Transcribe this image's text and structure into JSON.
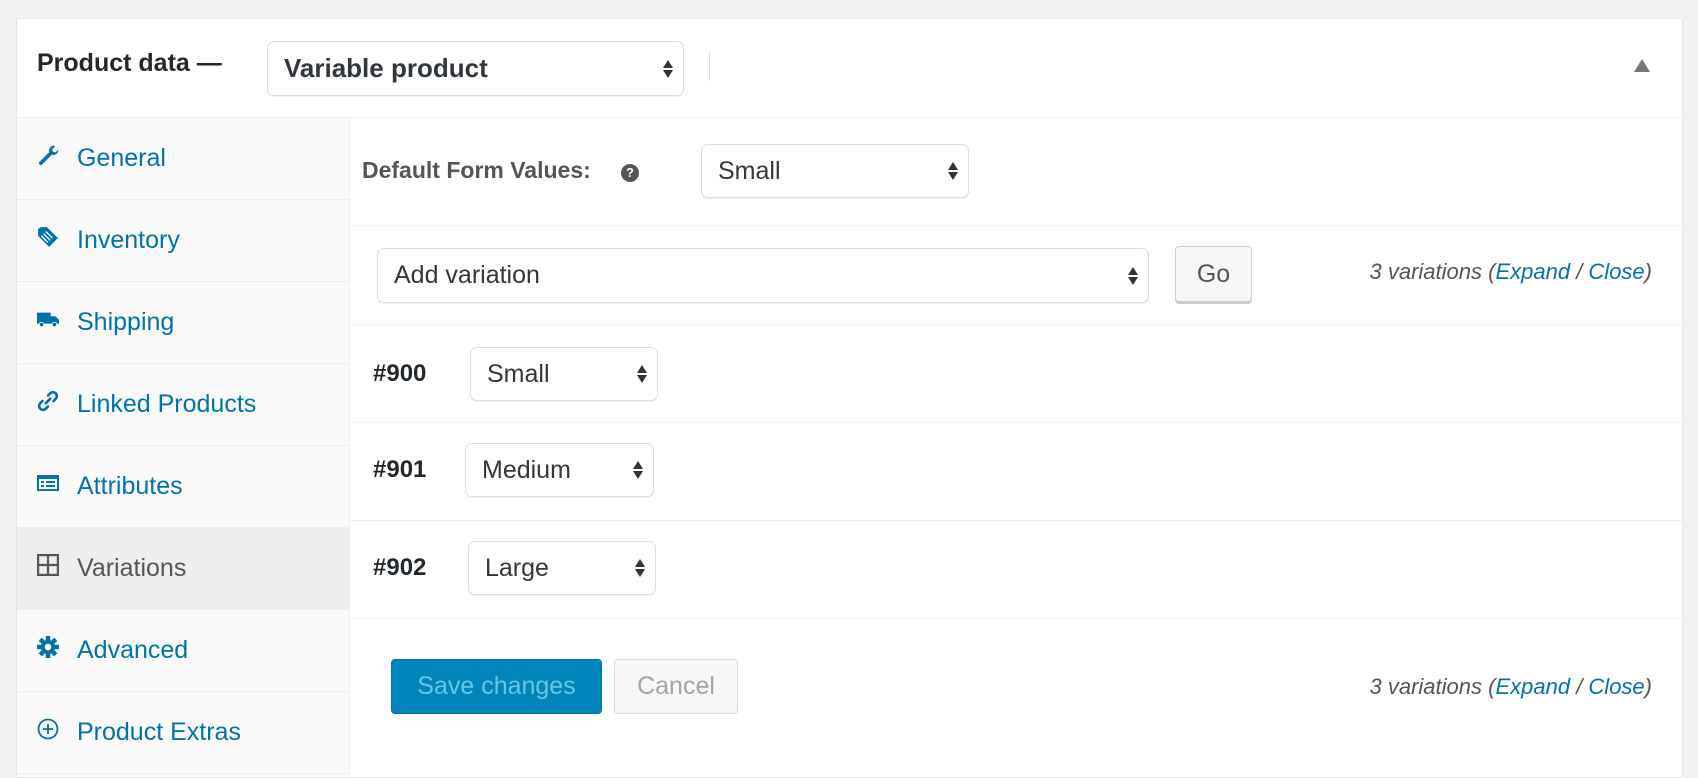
{
  "header": {
    "title": "Product data —",
    "product_type": "Variable product",
    "collapse_icon": "triangle-up-icon"
  },
  "sidebar": {
    "items": [
      {
        "label": "General",
        "icon": "wrench-icon",
        "active": false
      },
      {
        "label": "Inventory",
        "icon": "tag-icon",
        "active": false
      },
      {
        "label": "Shipping",
        "icon": "truck-icon",
        "active": false
      },
      {
        "label": "Linked Products",
        "icon": "link-icon",
        "active": false
      },
      {
        "label": "Attributes",
        "icon": "list-card-icon",
        "active": false
      },
      {
        "label": "Variations",
        "icon": "grid-icon",
        "active": true
      },
      {
        "label": "Advanced",
        "icon": "gear-icon",
        "active": false
      },
      {
        "label": "Product Extras",
        "icon": "plus-circle-icon",
        "active": false
      }
    ]
  },
  "main": {
    "default_form": {
      "label": "Default Form Values:",
      "help_icon": "?",
      "value": "Small"
    },
    "add_variation": {
      "value": "Add variation",
      "go_label": "Go"
    },
    "count": {
      "text": "3 variations (",
      "expand": "Expand",
      "separator": " / ",
      "close": "Close",
      "end": ")"
    },
    "variations": [
      {
        "id": "#900",
        "value": "Small"
      },
      {
        "id": "#901",
        "value": "Medium"
      },
      {
        "id": "#902",
        "value": "Large"
      }
    ],
    "save_label": "Save changes",
    "cancel_label": "Cancel"
  },
  "colors": {
    "accent": "#0073aa",
    "primary_button": "#0085ba",
    "active_tab_bg": "#eeeeee",
    "sidebar_bg": "#fafafa"
  }
}
